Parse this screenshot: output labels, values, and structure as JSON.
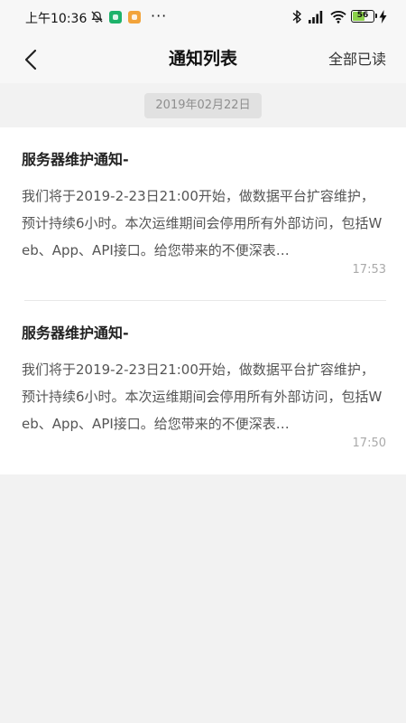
{
  "status_bar": {
    "time": "上午10:36",
    "battery": "56",
    "more": "···"
  },
  "header": {
    "title": "通知列表",
    "action": "全部已读"
  },
  "date_label": "2019年02月22日",
  "notices": [
    {
      "title": "服务器维护通知-",
      "body": "我们将于2019-2-23日21:00开始，做数据平台扩容维护，预计持续6小时。本次运维期间会停用所有外部访问，包括Web、App、API接口。给您带来的不便深表…",
      "time": "17:53"
    },
    {
      "title": "服务器维护通知-",
      "body": "我们将于2019-2-23日21:00开始，做数据平台扩容维护，预计持续6小时。本次运维期间会停用所有外部访问，包括Web、App、API接口。给您带来的不便深表…",
      "time": "17:50"
    }
  ],
  "colors": {
    "background": "#f2f2f2",
    "bars": "#f7f7f7",
    "card": "#ffffff",
    "battery_fill": "#8bd14a"
  }
}
